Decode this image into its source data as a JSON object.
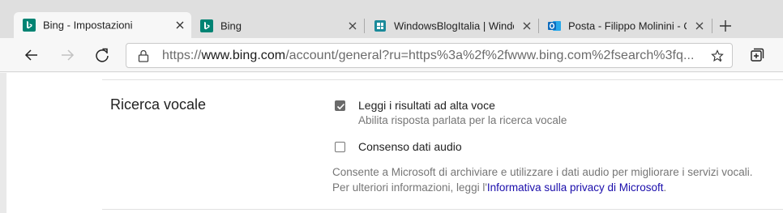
{
  "tabs": [
    {
      "title": "Bing - Impostazioni",
      "icon": "bing-icon",
      "active": true
    },
    {
      "title": "Bing",
      "icon": "bing-icon",
      "active": false
    },
    {
      "title": "WindowsBlogItalia | Windows",
      "icon": "windowsblogitalia-icon",
      "active": false
    },
    {
      "title": "Posta - Filippo Molinini - Outlook",
      "icon": "outlook-icon",
      "active": false
    }
  ],
  "address_bar": {
    "scheme": "https://",
    "host": "www.bing.com",
    "path": "/account/general?ru=https%3a%2f%2fwww.bing.com%2fsearch%3fq..."
  },
  "settings": {
    "section_title": "Ricerca vocale",
    "read_aloud": {
      "label": "Leggi i risultati ad alta voce",
      "sublabel": "Abilita risposta parlata per la ricerca vocale",
      "checked": true
    },
    "audio_consent": {
      "label": "Consenso dati audio",
      "checked": false
    },
    "description_line1": "Consente a Microsoft di archiviare e utilizzare i dati audio per migliorare i servizi vocali.",
    "description_line2_prefix": "Per ulteriori informazioni, leggi l'",
    "privacy_link": "Informativa sulla privacy di Microsoft",
    "description_line2_suffix": "."
  },
  "colors": {
    "bing_teal": "#008373",
    "windowsblog_teal": "#1a8a9a",
    "outlook_blue": "#0f6cbd",
    "link": "#1a0dab"
  }
}
